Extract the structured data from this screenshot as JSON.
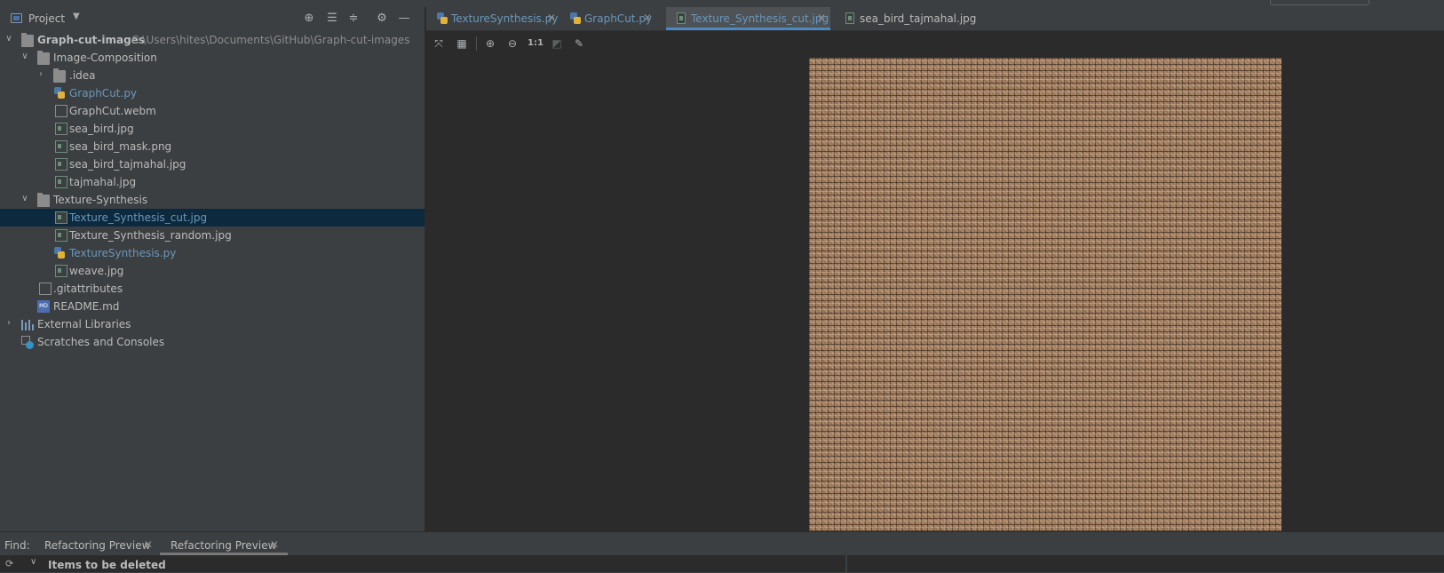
{
  "project_panel": {
    "title": "Project",
    "tree": [
      {
        "label": "Graph-cut-images",
        "path": "C:\\Users\\hites\\Documents\\GitHub\\Graph-cut-images"
      },
      {
        "label": "Image-Composition"
      },
      {
        "label": ".idea"
      },
      {
        "label": "GraphCut.py"
      },
      {
        "label": "GraphCut.webm"
      },
      {
        "label": "sea_bird.jpg"
      },
      {
        "label": "sea_bird_mask.png"
      },
      {
        "label": "sea_bird_tajmahal.jpg"
      },
      {
        "label": "tajmahal.jpg"
      },
      {
        "label": "Texture-Synthesis"
      },
      {
        "label": "Texture_Synthesis_cut.jpg"
      },
      {
        "label": "Texture_Synthesis_random.jpg"
      },
      {
        "label": "TextureSynthesis.py"
      },
      {
        "label": "weave.jpg"
      },
      {
        "label": ".gitattributes"
      },
      {
        "label": "README.md"
      },
      {
        "label": "External Libraries"
      },
      {
        "label": "Scratches and Consoles"
      }
    ]
  },
  "editor": {
    "tabs": [
      {
        "label": "TextureSynthesis.py"
      },
      {
        "label": "GraphCut.py"
      },
      {
        "label": "Texture_Synthesis_cut.jpg"
      },
      {
        "label": "sea_bird_tajmahal.jpg"
      }
    ],
    "toolbar": {
      "actual_size_label": "1:1"
    }
  },
  "bottom_panel": {
    "find_label": "Find:",
    "tabs": [
      {
        "label": "Refactoring Preview"
      },
      {
        "label": "Refactoring Preview"
      }
    ],
    "items_deleted": "Items to be deleted"
  },
  "colors": {
    "background": "#2b2b2b",
    "panel": "#3c3f41",
    "selection": "#0d293e",
    "accent": "#4a88c7",
    "link_text": "#6897bb"
  }
}
